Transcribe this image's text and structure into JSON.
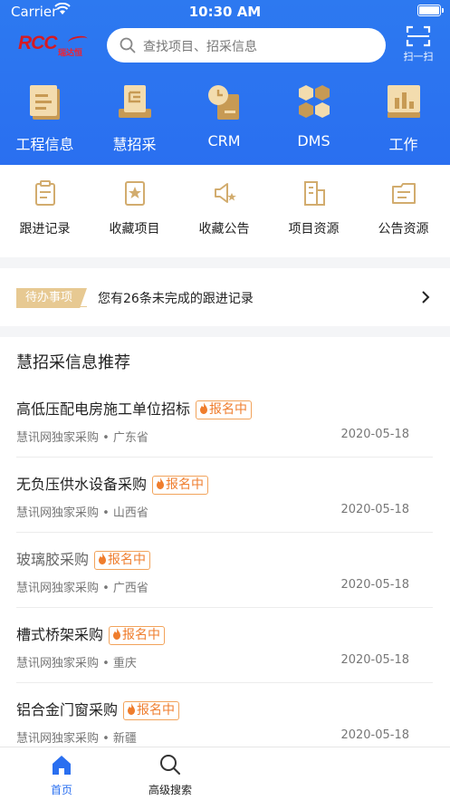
{
  "status_bar": {
    "carrier": "Carrier",
    "time": "10:30 AM"
  },
  "header": {
    "logo": {
      "main": "RCC",
      "sub": "瑞达恒"
    },
    "search": {
      "placeholder": "查找项目、招采信息"
    },
    "scan": {
      "label": "扫一扫"
    }
  },
  "top_nav": [
    {
      "label": "工程信息",
      "icon": "document-icon"
    },
    {
      "label": "慧招采",
      "icon": "tray-icon"
    },
    {
      "label": "CRM",
      "icon": "clock-icon"
    },
    {
      "label": "DMS",
      "icon": "hexagon-icon"
    },
    {
      "label": "工作",
      "icon": "chart-icon"
    }
  ],
  "quick_actions": [
    {
      "label": "跟进记录",
      "icon": "clipboard-icon"
    },
    {
      "label": "收藏项目",
      "icon": "star-doc-icon"
    },
    {
      "label": "收藏公告",
      "icon": "megaphone-star-icon"
    },
    {
      "label": "项目资源",
      "icon": "building-icon"
    },
    {
      "label": "公告资源",
      "icon": "folder-doc-icon"
    }
  ],
  "todo": {
    "tag": "待办事项",
    "text": "您有26条未完成的跟进记录"
  },
  "recommend": {
    "title": "慧招采信息推荐",
    "items": [
      {
        "title": "高低压配电房施工单位招标",
        "badge": "报名中",
        "source": "慧讯网独家采购 • 广东省",
        "date": "2020-05-18"
      },
      {
        "title": "无负压供水设备采购",
        "badge": "报名中",
        "source": "慧讯网独家采购 • 山西省",
        "date": "2020-05-18"
      },
      {
        "title": "玻璃胶采购",
        "badge": "报名中",
        "source": "慧讯网独家采购 • 广西省",
        "date": "2020-05-18"
      },
      {
        "title": "槽式桥架采购",
        "badge": "报名中",
        "source": "慧讯网独家采购 • 重庆",
        "date": "2020-05-18"
      },
      {
        "title": "铝合金门窗采购",
        "badge": "报名中",
        "source": "慧讯网独家采购 • 新疆",
        "date": "2020-05-18"
      }
    ]
  },
  "tab_bar": [
    {
      "label": "首页",
      "icon": "home-icon",
      "active": true
    },
    {
      "label": "高级搜索",
      "icon": "search-icon",
      "active": false
    }
  ],
  "colors": {
    "primary": "#2a6ff0",
    "accent_gold": "#e7c992",
    "badge_orange": "#ef7d2d",
    "icon_tan": "#d2ac6e"
  }
}
